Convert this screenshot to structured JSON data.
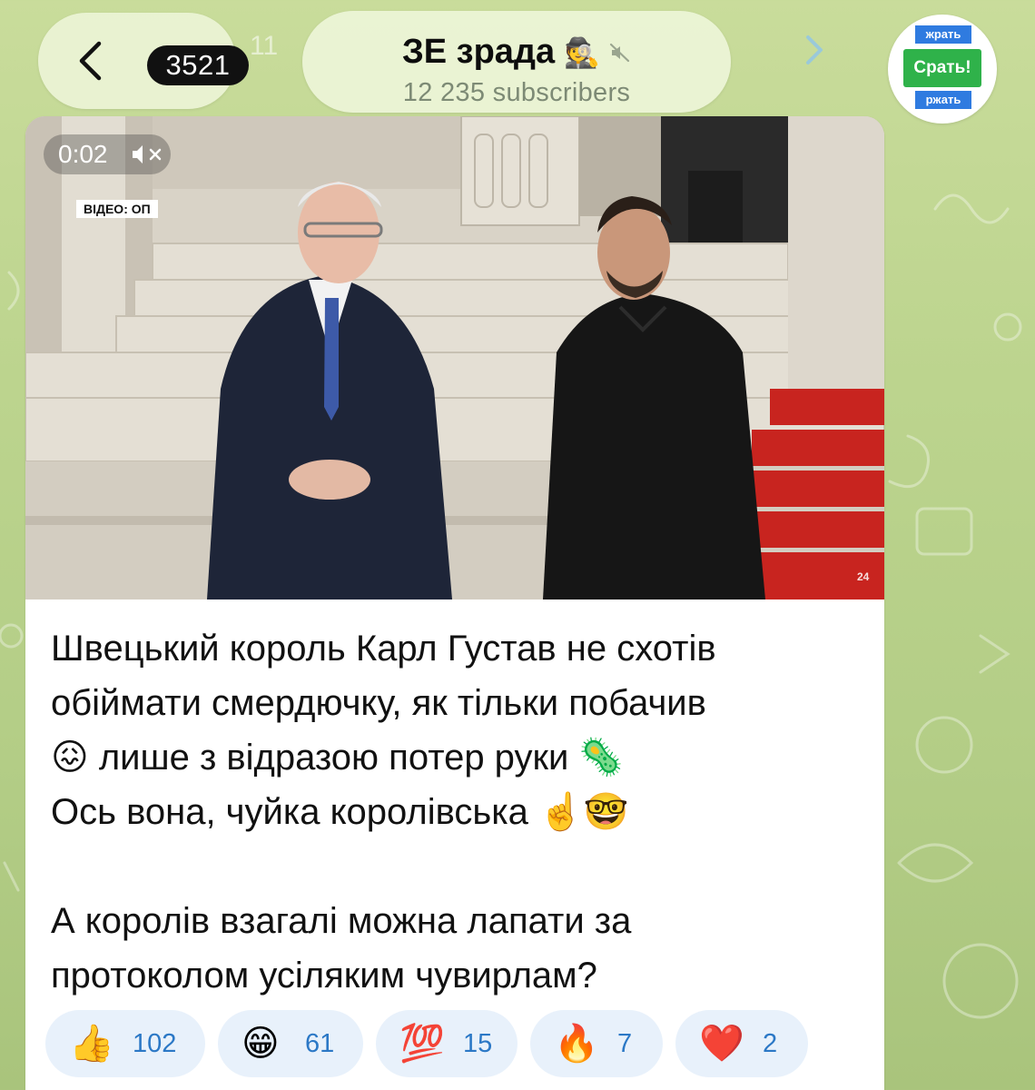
{
  "header": {
    "back_count": "3521",
    "channel_title": "ЗЕ зрада",
    "channel_emoji": "🕵️",
    "subscribers": "12 235 subscribers",
    "avatar_text_top": "жрать",
    "avatar_text_middle": "Срать!",
    "avatar_text_bottom": "ржать",
    "ghost_text": "11"
  },
  "video": {
    "time": "0:02",
    "overlay_label": "ВІДЕО: ОП",
    "watermark": "24"
  },
  "message": {
    "text": "Швецький король Карл Густав не схотів\nобіймати смердючку, як тільки побачив\n😖 лише з відразою потер руки 🦠\nОсь вона, чуйка королівська ☝️🤓\n\nА королів взагалі можна лапати за\nпротоколом усіляким чувирлам?"
  },
  "reactions": [
    {
      "emoji": "👍",
      "count": "102"
    },
    {
      "emoji": "😁",
      "count": "61"
    },
    {
      "emoji": "💯",
      "count": "15"
    },
    {
      "emoji": "🔥",
      "count": "7"
    },
    {
      "emoji": "❤️",
      "count": "2"
    }
  ],
  "colors": {
    "wallpaper": "#bcd48e",
    "pill": "#ecf4d6",
    "reaction_bg": "#e8f1fb",
    "reaction_count": "#2b78c6",
    "carpet": "#c8241f"
  }
}
